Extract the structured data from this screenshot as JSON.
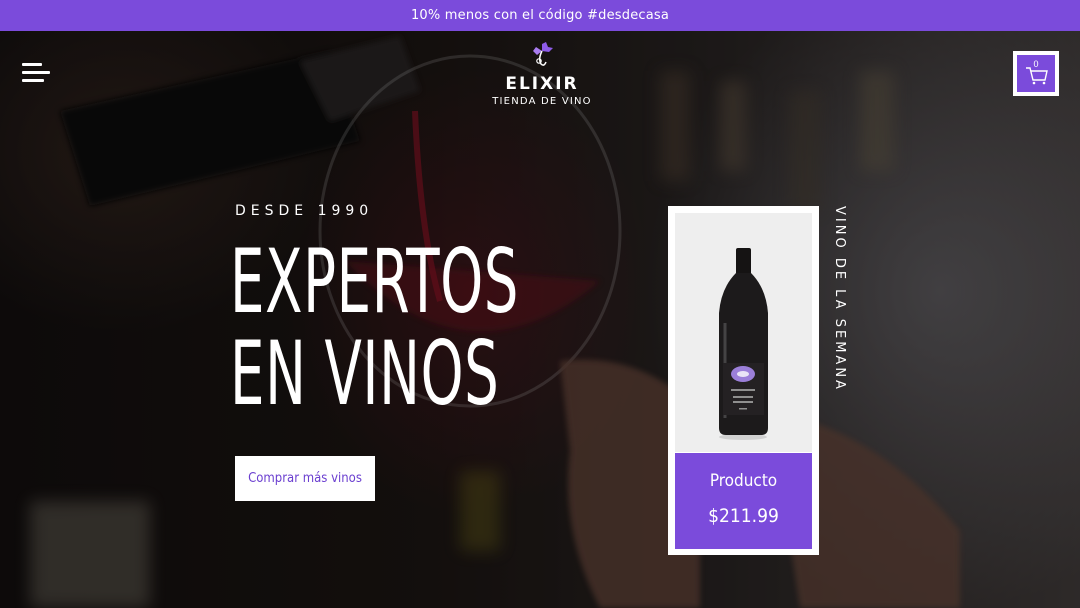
{
  "promo": {
    "text": "10% menos con el código #desdecasa"
  },
  "header": {
    "brand_name": "ELIXIR",
    "brand_tagline": "TIENDA DE VINO",
    "cart_count": "0"
  },
  "hero": {
    "eyebrow": "DESDE 1990",
    "headline_line1": "EXPERTOS",
    "headline_line2": "EN VINOS",
    "cta_label": "Comprar más vinos"
  },
  "featured": {
    "section_label": "VINO DE LA SEMANA",
    "product_name": "Producto",
    "product_price": "$211.99"
  },
  "colors": {
    "accent": "#7b4bdb",
    "text_light": "#ffffff"
  },
  "icons": [
    "menu-icon",
    "grape-logo-icon",
    "cart-icon",
    "wine-bottle-image"
  ]
}
